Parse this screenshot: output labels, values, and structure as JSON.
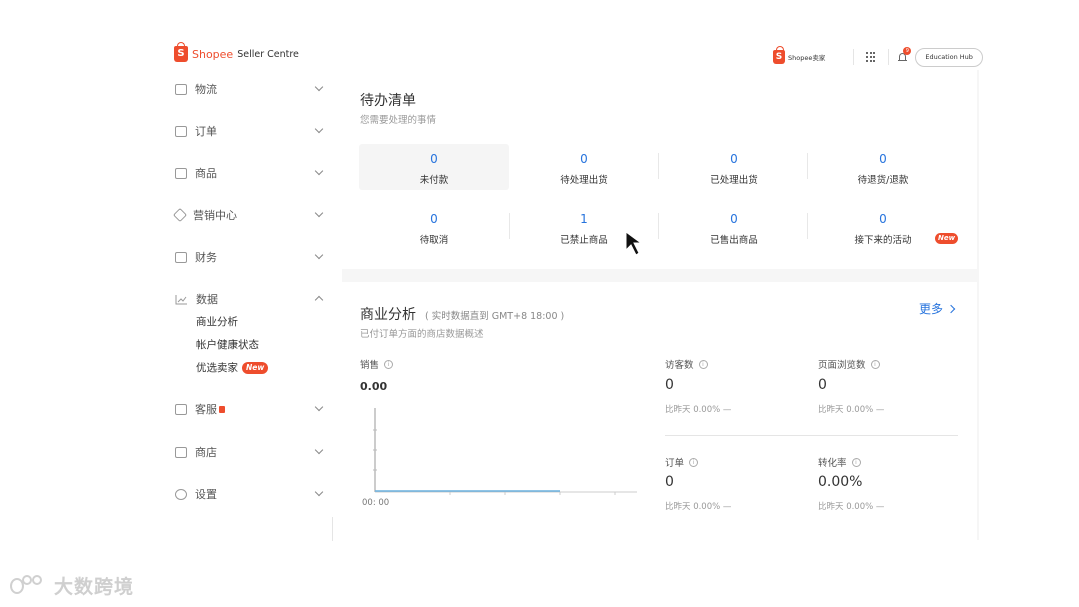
{
  "header": {
    "brand": "Shopee",
    "product": "Seller Centre",
    "right_logo_text": "Shopee卖家",
    "notification_count": "9",
    "education_hub": "Education Hub",
    "accent_color": "#ee4d2d"
  },
  "sidebar": {
    "items": [
      {
        "label": "物流",
        "icon": "truck-icon"
      },
      {
        "label": "订单",
        "icon": "clipboard-icon"
      },
      {
        "label": "商品",
        "icon": "box-icon"
      },
      {
        "label": "营销中心",
        "icon": "tag-icon"
      },
      {
        "label": "财务",
        "icon": "wallet-icon"
      },
      {
        "label": "数据",
        "icon": "chart-line-icon",
        "expanded": true
      },
      {
        "label": "客服",
        "icon": "chat-icon"
      },
      {
        "label": "商店",
        "icon": "store-icon"
      },
      {
        "label": "设置",
        "icon": "gear-icon"
      }
    ],
    "data_subitems": [
      "商业分析",
      "帐户健康状态",
      "优选卖家"
    ],
    "new_badge": "New"
  },
  "todo": {
    "title": "待办清单",
    "subtitle": "您需要处理的事情",
    "items": [
      {
        "value": "0",
        "label": "未付款"
      },
      {
        "value": "0",
        "label": "待处理出货"
      },
      {
        "value": "0",
        "label": "已处理出货"
      },
      {
        "value": "0",
        "label": "待退货/退款"
      },
      {
        "value": "0",
        "label": "待取消"
      },
      {
        "value": "1",
        "label": "已禁止商品"
      },
      {
        "value": "0",
        "label": "已售出商品"
      },
      {
        "value": "0",
        "label": "接下来的活动"
      }
    ],
    "new_tag": "New"
  },
  "analytics": {
    "title": "商业分析",
    "realtime_note": "( 实时数据直到 GMT+8 18:00 )",
    "subtitle": "已付订单方面的商店数据概述",
    "more": "更多",
    "sales_label": "销售",
    "sales_value": "0.00",
    "chart_time": "00: 00",
    "metrics": [
      {
        "label": "访客数",
        "value": "0",
        "compare": "比昨天 0.00% —"
      },
      {
        "label": "页面浏览数",
        "value": "0",
        "compare": "比昨天 0.00% —"
      },
      {
        "label": "订单",
        "value": "0",
        "compare": "比昨天 0.00% —"
      },
      {
        "label": "转化率",
        "value": "0.00%",
        "compare": "比昨天 0.00% —"
      }
    ]
  },
  "watermark": "大数跨境"
}
